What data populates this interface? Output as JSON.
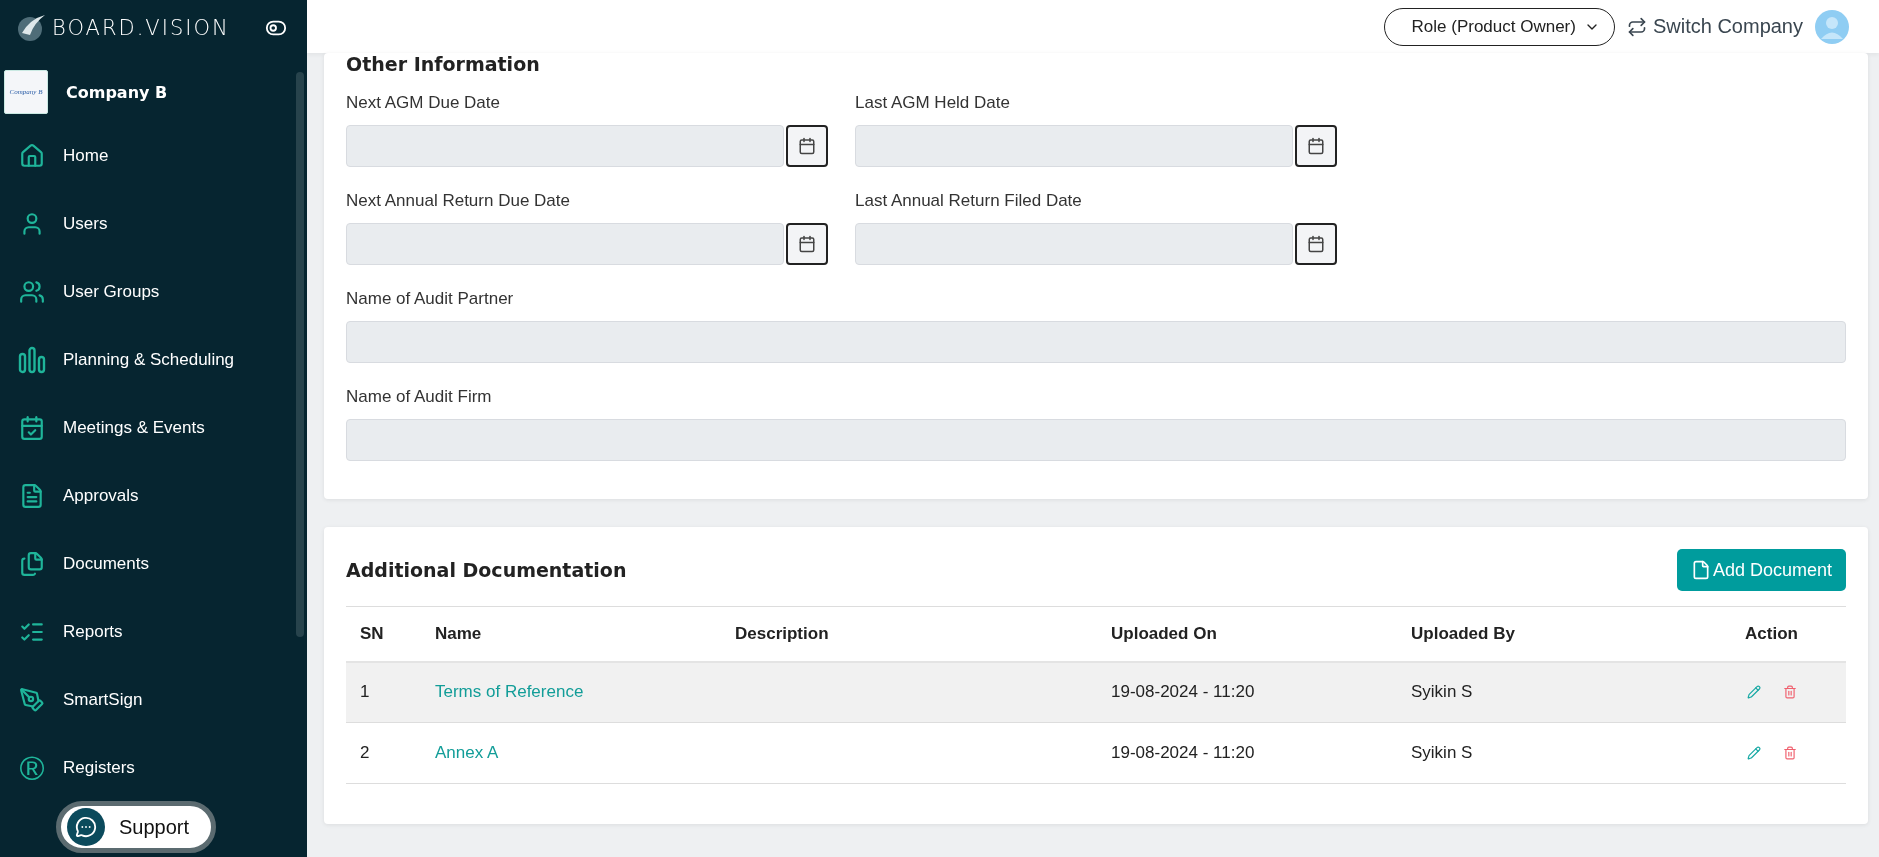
{
  "brand": {
    "name": "BOARD.VISION"
  },
  "company": {
    "name": "Company B",
    "logo_text": "Company B"
  },
  "sidebar": {
    "items": [
      {
        "label": "Home",
        "selected": false
      },
      {
        "label": "Users",
        "selected": false
      },
      {
        "label": "User Groups",
        "selected": false
      },
      {
        "label": "Planning & Scheduling",
        "selected": false
      },
      {
        "label": "Meetings & Events",
        "selected": false
      },
      {
        "label": "Approvals",
        "selected": false
      },
      {
        "label": "Documents",
        "selected": false
      },
      {
        "label": "Reports",
        "selected": false
      },
      {
        "label": "SmartSign",
        "selected": false
      },
      {
        "label": "Registers",
        "selected": false,
        "glyph": "®"
      }
    ]
  },
  "support": {
    "label": "Support"
  },
  "header": {
    "role": "Role (Product Owner)",
    "switch": "Switch Company"
  },
  "other_information": {
    "title": "Other Information",
    "fields": [
      {
        "label": "Next AGM Due Date",
        "kind": "date"
      },
      {
        "label": "Last AGM Held Date",
        "kind": "date"
      },
      {
        "label": "Next Annual Return Due Date",
        "kind": "date"
      },
      {
        "label": "Last Annual Return Filed Date",
        "kind": "date"
      },
      {
        "label": "Name of Audit Partner",
        "kind": "text"
      },
      {
        "label": "Name of Audit Firm",
        "kind": "text"
      }
    ]
  },
  "additional_documentation": {
    "title": "Additional Documentation",
    "add_button": "Add Document",
    "table": {
      "columns": [
        "SN",
        "Name",
        "Description",
        "Uploaded On",
        "Uploaded By",
        "Action"
      ],
      "rows": [
        {
          "sn": "1",
          "name": "Terms of Reference",
          "uploaded_on": "19-08-2024 - 11:20",
          "uploaded_by": "Syikin S",
          "highlighted": true
        },
        {
          "sn": "2",
          "name": "Annex A",
          "uploaded_on": "19-08-2024 - 11:20",
          "uploaded_by": "Syikin S",
          "highlighted": false
        }
      ]
    }
  }
}
